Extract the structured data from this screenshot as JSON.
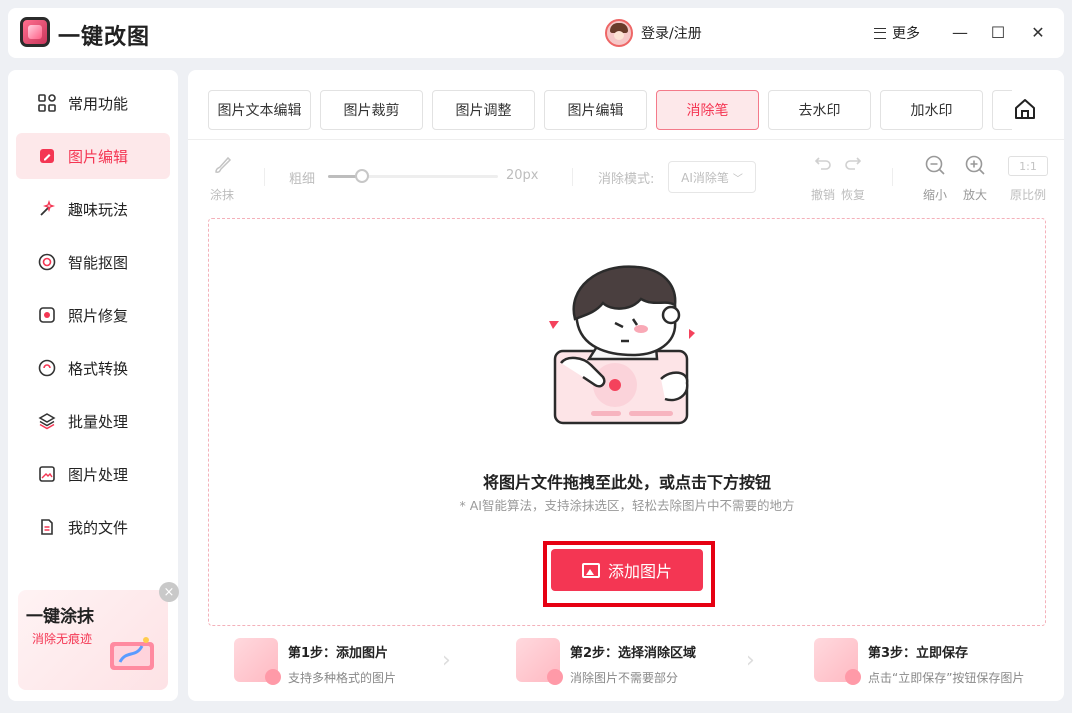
{
  "app": {
    "title": "一键改图",
    "login": "登录/注册",
    "more": "更多"
  },
  "window": {
    "minimize": "—",
    "maximize": "☐",
    "close": "✕"
  },
  "sidebar": {
    "items": [
      {
        "label": "常用功能",
        "icon": "grid-icon"
      },
      {
        "label": "图片编辑",
        "icon": "edit-icon",
        "active": true
      },
      {
        "label": "趣味玩法",
        "icon": "magic-wand-icon"
      },
      {
        "label": "智能抠图",
        "icon": "target-icon"
      },
      {
        "label": "照片修复",
        "icon": "repair-icon"
      },
      {
        "label": "格式转换",
        "icon": "convert-icon"
      },
      {
        "label": "批量处理",
        "icon": "layers-icon"
      },
      {
        "label": "图片处理",
        "icon": "image-icon"
      },
      {
        "label": "我的文件",
        "icon": "file-icon"
      }
    ],
    "promo": {
      "title": "一键涂抹",
      "subtitle": "消除无痕迹"
    }
  },
  "tabs": [
    {
      "label": "图片文本编辑"
    },
    {
      "label": "图片裁剪"
    },
    {
      "label": "图片调整"
    },
    {
      "label": "图片编辑"
    },
    {
      "label": "消除笔",
      "active": true
    },
    {
      "label": "去水印"
    },
    {
      "label": "加水印"
    }
  ],
  "toolbar": {
    "smear": "涂抹",
    "thickness_label": "粗细",
    "thickness_value": "20px",
    "thickness_fraction": 0.2,
    "mode_label": "消除模式:",
    "mode_value": "AI消除笔",
    "undo": "撤销",
    "redo": "恢复",
    "zoom_out": "缩小",
    "zoom_in": "放大",
    "ratio_box": "1:1",
    "ratio": "原比例"
  },
  "dropzone": {
    "title": "将图片文件拖拽至此处，或点击下方按钮",
    "subtitle": "* AI智能算法，支持涂抹选区，轻松去除图片中不需要的地方",
    "button": "添加图片"
  },
  "steps": [
    {
      "title": "第1步：添加图片",
      "desc": "支持多种格式的图片"
    },
    {
      "title": "第2步：选择消除区域",
      "desc": "消除图片不需要部分"
    },
    {
      "title": "第3步：立即保存",
      "desc": "点击“立即保存”按钮保存图片"
    }
  ],
  "colors": {
    "accent": "#f43653",
    "highlight_outline": "#e60012"
  }
}
